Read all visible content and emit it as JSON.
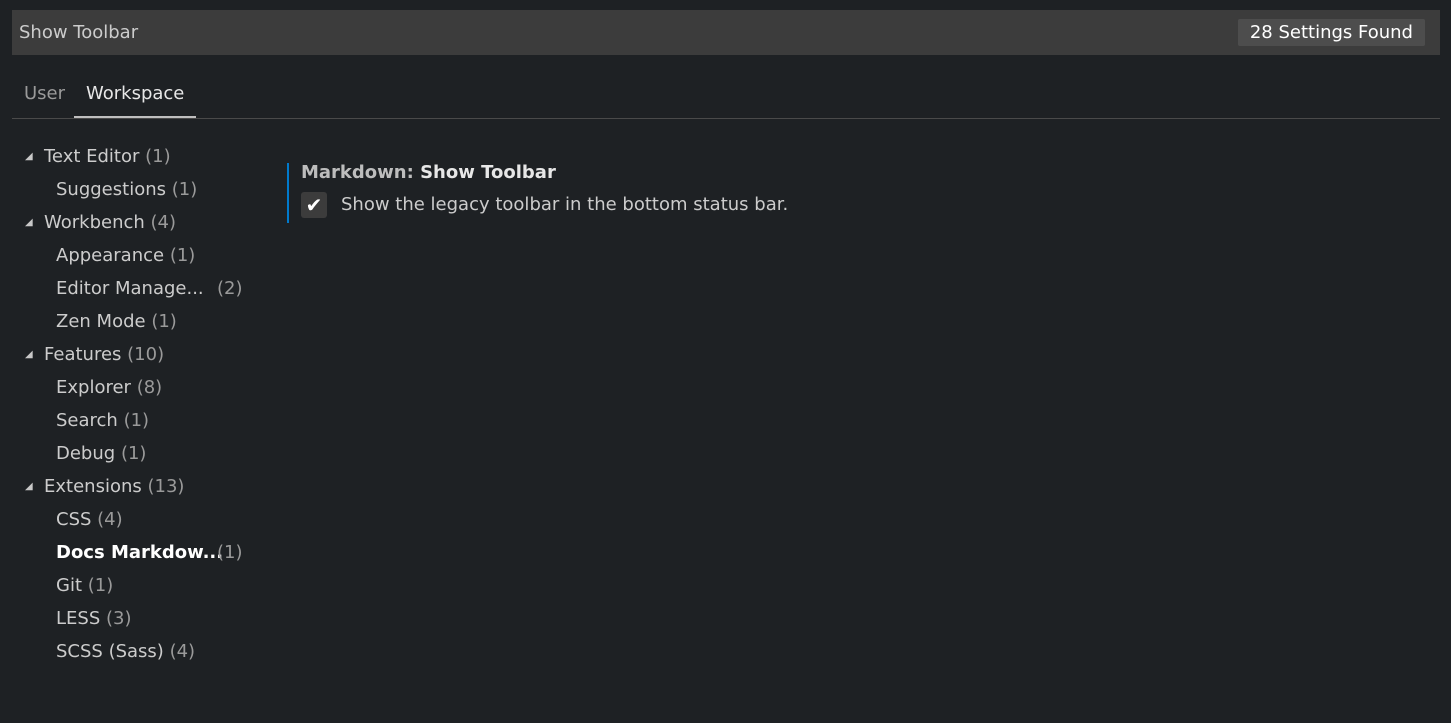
{
  "search": {
    "value": "Show Toolbar",
    "count_label": "28 Settings Found"
  },
  "tabs": [
    {
      "label": "User"
    },
    {
      "label": "Workspace"
    }
  ],
  "toc": {
    "items": [
      {
        "label": "Text Editor",
        "count": "(1)"
      },
      {
        "label": "Suggestions",
        "count": "(1)"
      },
      {
        "label": "Workbench",
        "count": "(4)"
      },
      {
        "label": "Appearance",
        "count": "(1)"
      },
      {
        "label": "Editor Manage...",
        "count": "(2)"
      },
      {
        "label": "Zen Mode",
        "count": "(1)"
      },
      {
        "label": "Features",
        "count": "(10)"
      },
      {
        "label": "Explorer",
        "count": "(8)"
      },
      {
        "label": "Search",
        "count": "(1)"
      },
      {
        "label": "Debug",
        "count": "(1)"
      },
      {
        "label": "Extensions",
        "count": "(13)"
      },
      {
        "label": "CSS",
        "count": "(4)"
      },
      {
        "label": "Docs Markdow...",
        "count": "(1)"
      },
      {
        "label": "Git",
        "count": "(1)"
      },
      {
        "label": "LESS",
        "count": "(3)"
      },
      {
        "label": "SCSS (Sass)",
        "count": "(4)"
      }
    ]
  },
  "setting": {
    "category": "Markdown: ",
    "key": "Show Toolbar",
    "checkbox_glyph": "✔",
    "description": "Show the legacy toolbar in the bottom status bar.",
    "checked": true
  },
  "icons": {
    "expanded_twistie": "◢"
  },
  "colors": {
    "background": "#1e2124",
    "accent_border": "#007acc"
  }
}
